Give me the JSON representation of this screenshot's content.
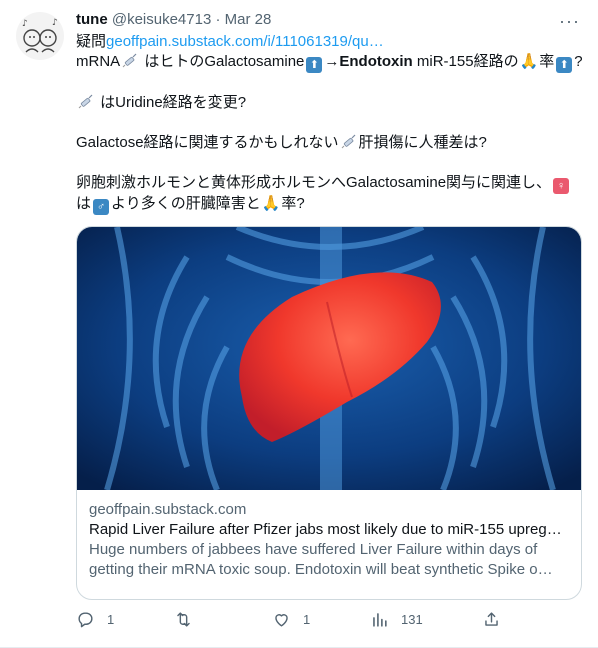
{
  "tweet": {
    "author_name": "tune",
    "author_handle": "@keisuke4713",
    "separator": "·",
    "date": "Mar 28",
    "line1_prefix": "疑問",
    "line1_link": "geoffpain.substack.com/i/111061319/qu…",
    "line2_a": "mRNA",
    "line2_b": " はヒトのGalactosamine",
    "line2_c": "→",
    "line2_d": "Endotoxin",
    "line2_e": " miR-155経路の",
    "line2_f": "率",
    "line2_g": "?",
    "line3_a": " はUridine経路を変更?",
    "line4_a": "Galactose経路に関連するかもしれない",
    "line4_b": "肝損傷に人種差は?",
    "line5_a": "卵胞刺激ホルモンと黄体形成ホルモンへGalactosamine関与に関連し、",
    "line6_a": "は",
    "line6_b": "より多くの肝臓障害と",
    "line6_c": "率?",
    "arrow_up": "⬆",
    "female_sign": "♀",
    "male_sign": "♂",
    "pray": "🙏"
  },
  "card": {
    "domain": "geoffpain.substack.com",
    "title": "Rapid Liver Failure after Pfizer jabs most likely due to miR-155 upreg…",
    "desc_line1": "Huge numbers of jabbees have suffered Liver Failure within days of",
    "desc_line2": "getting their mRNA toxic soup. Endotoxin will beat synthetic Spike o…"
  },
  "actions": {
    "reply_count": "1",
    "retweet_count": "",
    "like_count": "1",
    "views_count": "131"
  },
  "icons": {
    "more": "more-options-icon",
    "reply": "reply-icon",
    "retweet": "retweet-icon",
    "like": "like-icon",
    "views": "views-icon",
    "share": "share-icon",
    "syringe": "syringe-icon"
  },
  "colors": {
    "link": "#1d9bf0",
    "muted": "#536471",
    "emoji_blue": "#3b88c3",
    "emoji_pink": "#ea596e"
  }
}
